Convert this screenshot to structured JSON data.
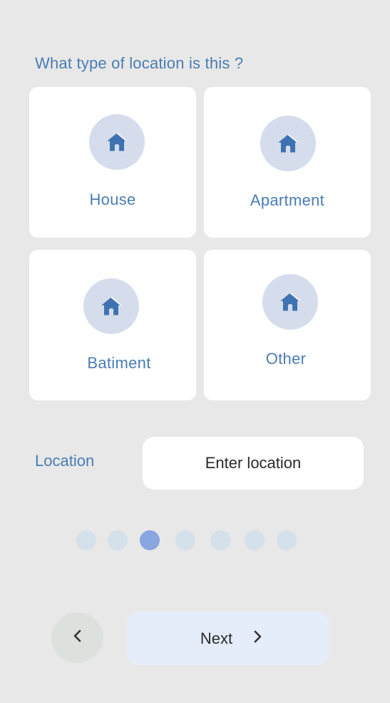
{
  "question": "What type of location is this ?",
  "options": [
    {
      "label": "House",
      "icon": "home-icon"
    },
    {
      "label": "Apartment",
      "icon": "home-icon"
    },
    {
      "label": "Batiment",
      "icon": "home-icon"
    },
    {
      "label": "Other",
      "icon": "home-icon"
    }
  ],
  "location": {
    "label": "Location",
    "placeholder": "Enter location",
    "value": ""
  },
  "pagination": {
    "total_steps": 7,
    "current_step": 3
  },
  "nav": {
    "back_icon": "chevron-left-icon",
    "next_label": "Next",
    "next_icon": "chevron-right-icon"
  },
  "colors": {
    "background": "#e8e8e8",
    "accent_text": "#4a7db3",
    "icon_blue": "#3f72b0",
    "icon_circle": "#d5ddec",
    "dot_inactive": "#d4e0ea",
    "dot_active": "#88a6df",
    "next_button_bg": "#e5edfb",
    "back_button_bg": "#dde1de"
  }
}
